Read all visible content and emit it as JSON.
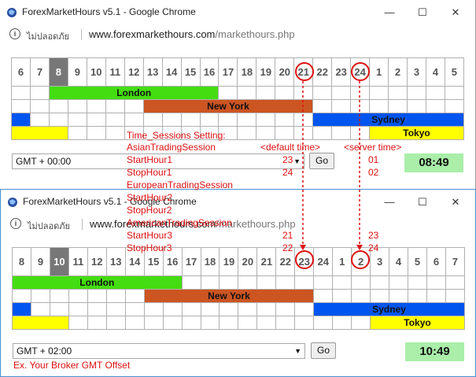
{
  "window1": {
    "title": "ForexMarketHours v5.1 - Google Chrome",
    "insecure_label": "ไม่ปลอดภัย",
    "url_host": "www.forexmarkethours.com",
    "url_path": "/markethours.php",
    "hours": [
      "6",
      "7",
      "8",
      "9",
      "10",
      "11",
      "12",
      "13",
      "14",
      "15",
      "16",
      "17",
      "18",
      "19",
      "20",
      "21",
      "22",
      "23",
      "24",
      "1",
      "2",
      "3",
      "4",
      "5"
    ],
    "current_hour": "8",
    "sessions": {
      "london": "London",
      "newyork": "New York",
      "sydney": "Sydney",
      "tokyo": "Tokyo"
    },
    "gmt_value": "GMT + 00:00",
    "go_label": "Go",
    "clock": "08:49"
  },
  "window2": {
    "title": "ForexMarketHours v5.1 - Google Chrome",
    "insecure_label": "ไม่ปลอดภัย",
    "url_host": "www.forexmarkethours.com",
    "url_path": "/markethours.php",
    "hours": [
      "8",
      "9",
      "10",
      "11",
      "12",
      "13",
      "14",
      "15",
      "16",
      "17",
      "18",
      "19",
      "20",
      "21",
      "22",
      "23",
      "24",
      "1",
      "2",
      "3",
      "4",
      "5",
      "6",
      "7"
    ],
    "current_hour": "10",
    "sessions": {
      "london": "London",
      "newyork": "New York",
      "sydney": "Sydney",
      "tokyo": "Tokyo"
    },
    "gmt_value": "GMT + 02:00",
    "go_label": "Go",
    "clock": "10:49"
  },
  "annotation": {
    "heading": "Time_Sessions Setting:",
    "asian": "AsianTradingSession",
    "default_time": "<default time>",
    "server_time": "<server time>",
    "start1": "StartHour1",
    "start1_default": "23",
    "start1_server": "01",
    "stop1": "StopHour1",
    "stop1_default": "24",
    "stop1_server": "02",
    "european": "EuropeanTradingSession",
    "start2": "StartHour2",
    "stop2": "StopHour2",
    "american": "AmericanTradingSession",
    "start3": "StartHour3",
    "start3_default": "21",
    "start3_server": "23",
    "stop3": "StopHour3",
    "stop3_default": "22",
    "stop3_server": "24",
    "broker_note": "Ex. Your Broker GMT Offset"
  },
  "colors": {
    "london": "#44dd11",
    "newyork": "#cc5522",
    "sydney": "#0055ee",
    "tokyo": "#ffff00",
    "clock_bg": "#aaeeaa",
    "annotation_red": "#dd1111"
  }
}
